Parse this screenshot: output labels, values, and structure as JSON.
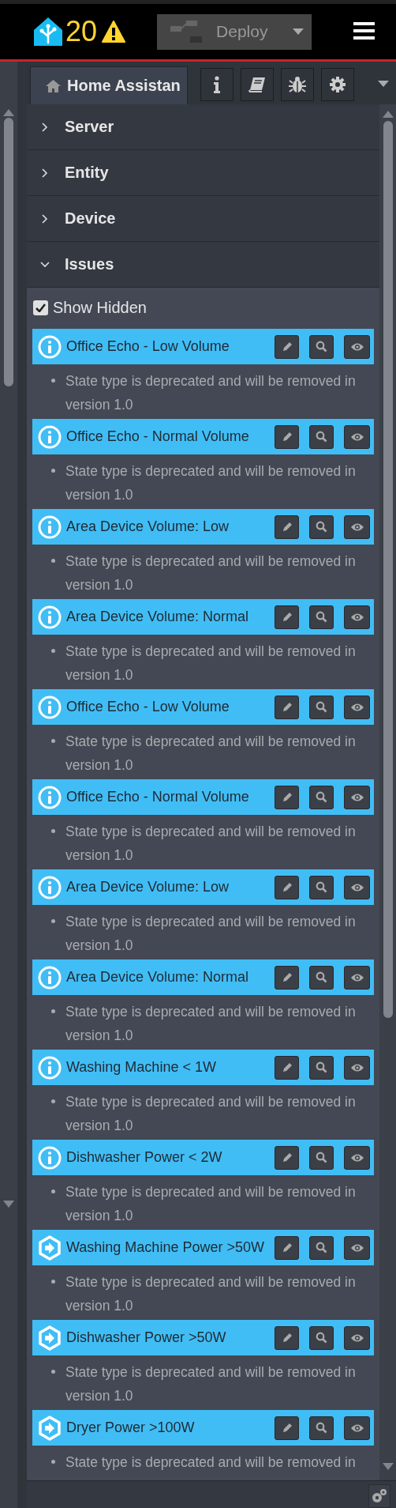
{
  "header": {
    "badge_count": "20",
    "deploy": {
      "label": "Deploy"
    }
  },
  "tab": {
    "label": "Home Assistan",
    "selected": true
  },
  "sections": [
    {
      "label": "Server",
      "expanded": false
    },
    {
      "label": "Entity",
      "expanded": false
    },
    {
      "label": "Device",
      "expanded": false
    },
    {
      "label": "Issues",
      "expanded": true
    }
  ],
  "show_hidden": {
    "label": "Show Hidden",
    "checked": true
  },
  "issues": [
    {
      "kind": "info",
      "title": "Office Echo - Low Volume",
      "message": "State type is deprecated and will be removed in version 1.0"
    },
    {
      "kind": "info",
      "title": "Office Echo - Normal Volume",
      "message": "State type is deprecated and will be removed in version 1.0"
    },
    {
      "kind": "info",
      "title": "Area Device Volume: Low",
      "message": "State type is deprecated and will be removed in version 1.0"
    },
    {
      "kind": "info",
      "title": "Area Device Volume: Normal",
      "message": "State type is deprecated and will be removed in version 1.0"
    },
    {
      "kind": "info",
      "title": "Office Echo - Low Volume",
      "message": "State type is deprecated and will be removed in version 1.0"
    },
    {
      "kind": "info",
      "title": "Office Echo - Normal Volume",
      "message": "State type is deprecated and will be removed in version 1.0"
    },
    {
      "kind": "info",
      "title": "Area Device Volume: Low",
      "message": "State type is deprecated and will be removed in version 1.0"
    },
    {
      "kind": "info",
      "title": "Area Device Volume: Normal",
      "message": "State type is deprecated and will be removed in version 1.0"
    },
    {
      "kind": "info",
      "title": "Washing Machine < 1W",
      "message": "State type is deprecated and will be removed in version 1.0"
    },
    {
      "kind": "info",
      "title": "Dishwasher Power < 2W",
      "message": "State type is deprecated and will be removed in version 1.0"
    },
    {
      "kind": "trigger",
      "title": "Washing Machine Power >50W",
      "message": "State type is deprecated and will be removed in version 1.0"
    },
    {
      "kind": "trigger",
      "title": "Dishwasher Power >50W",
      "message": "State type is deprecated and will be removed in version 1.0"
    },
    {
      "kind": "trigger",
      "title": "Dryer Power >100W",
      "message": "State type is deprecated and will be removed in"
    }
  ]
}
